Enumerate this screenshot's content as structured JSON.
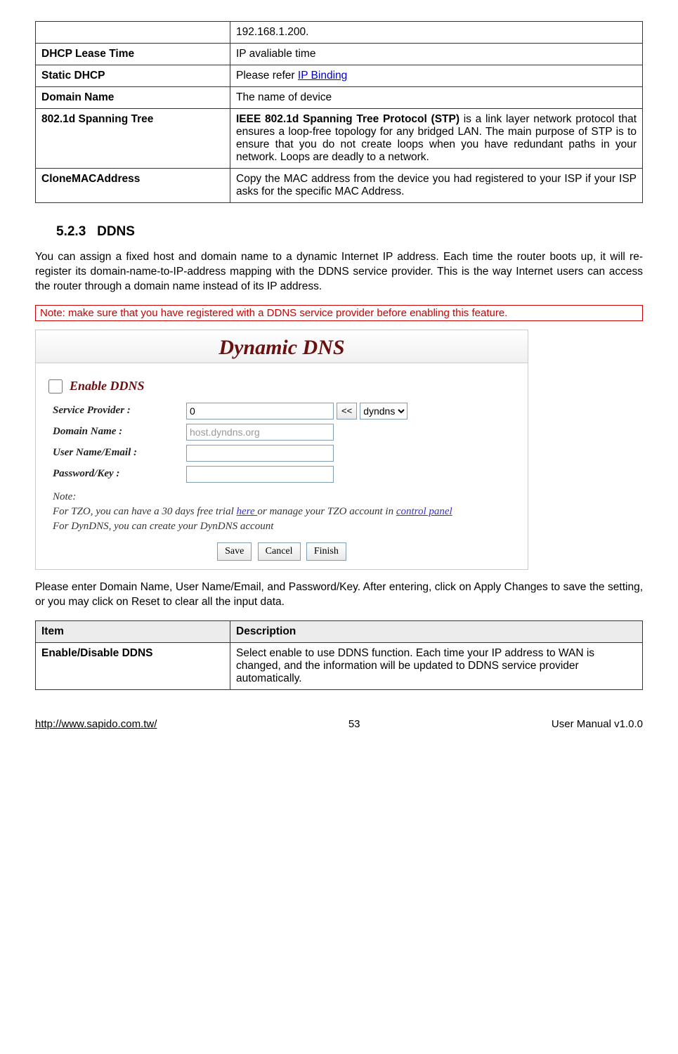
{
  "table1": {
    "rows": [
      {
        "item": "",
        "desc": "192.168.1.200."
      },
      {
        "item": "DHCP Lease Time",
        "desc": "IP avaliable time"
      },
      {
        "item": "Static DHCP",
        "desc_prefix": "Please refer ",
        "link": "IP Binding"
      },
      {
        "item": "Domain Name",
        "desc": "The name of device"
      },
      {
        "item": "802.1d Spanning Tree",
        "desc_bold": "IEEE 802.1d Spanning Tree Protocol (STP)",
        "desc_rest": " is a link layer network protocol that ensures a loop-free topology for any bridged LAN. The main purpose of STP is to ensure that you do not create loops when you have redundant paths in your network. Loops are deadly to a network."
      },
      {
        "item": "CloneMACAddress",
        "desc": "Copy the MAC address from the device you had registered to your ISP if your ISP asks for the specific MAC Address."
      }
    ]
  },
  "section": {
    "number": "5.2.3",
    "title": "DDNS",
    "paragraph1": "You can assign a fixed host and domain name to a dynamic Internet IP address. Each time the router boots up, it will re-register its domain-name-to-IP-address mapping with the DDNS service provider. This is the way Internet users can access the router through a domain name instead of its IP address.",
    "note": "Note: make sure that you have registered with a DDNS service provider before enabling this feature.",
    "paragraph2": "Please enter Domain Name, User Name/Email, and Password/Key. After entering, click on Apply Changes to save the setting, or you may click on Reset to clear all the input data."
  },
  "ddns_panel": {
    "title": "Dynamic DNS",
    "enable_label": "Enable DDNS",
    "labels": {
      "service_provider": "Service Provider :",
      "domain_name": "Domain Name :",
      "user_name": "User Name/Email :",
      "password": "Password/Key :"
    },
    "values": {
      "service_provider": "0",
      "arrow": "<<",
      "select_value": "dyndns",
      "domain_placeholder": "host.dyndns.org",
      "user_name": "",
      "password": ""
    },
    "note_label": "Note:",
    "note_line1a": "For TZO, you can have a 30 days free trial ",
    "note_link1": "here ",
    "note_line1b": "or manage your TZO account in ",
    "note_link2": "control panel",
    "note_line2": "For DynDNS, you can create your DynDNS account ",
    "buttons": {
      "save": "Save",
      "cancel": "Cancel",
      "finish": "Finish"
    }
  },
  "table2": {
    "headers": {
      "item": "Item",
      "desc": "Description"
    },
    "rows": [
      {
        "item": "Enable/Disable DDNS",
        "desc": "Select enable to use DDNS function. Each time your IP address to WAN is changed, and the information will be updated to DDNS service provider automatically."
      }
    ]
  },
  "footer": {
    "url": "http://www.sapido.com.tw/",
    "page": "53",
    "right": "User Manual v1.0.0"
  }
}
